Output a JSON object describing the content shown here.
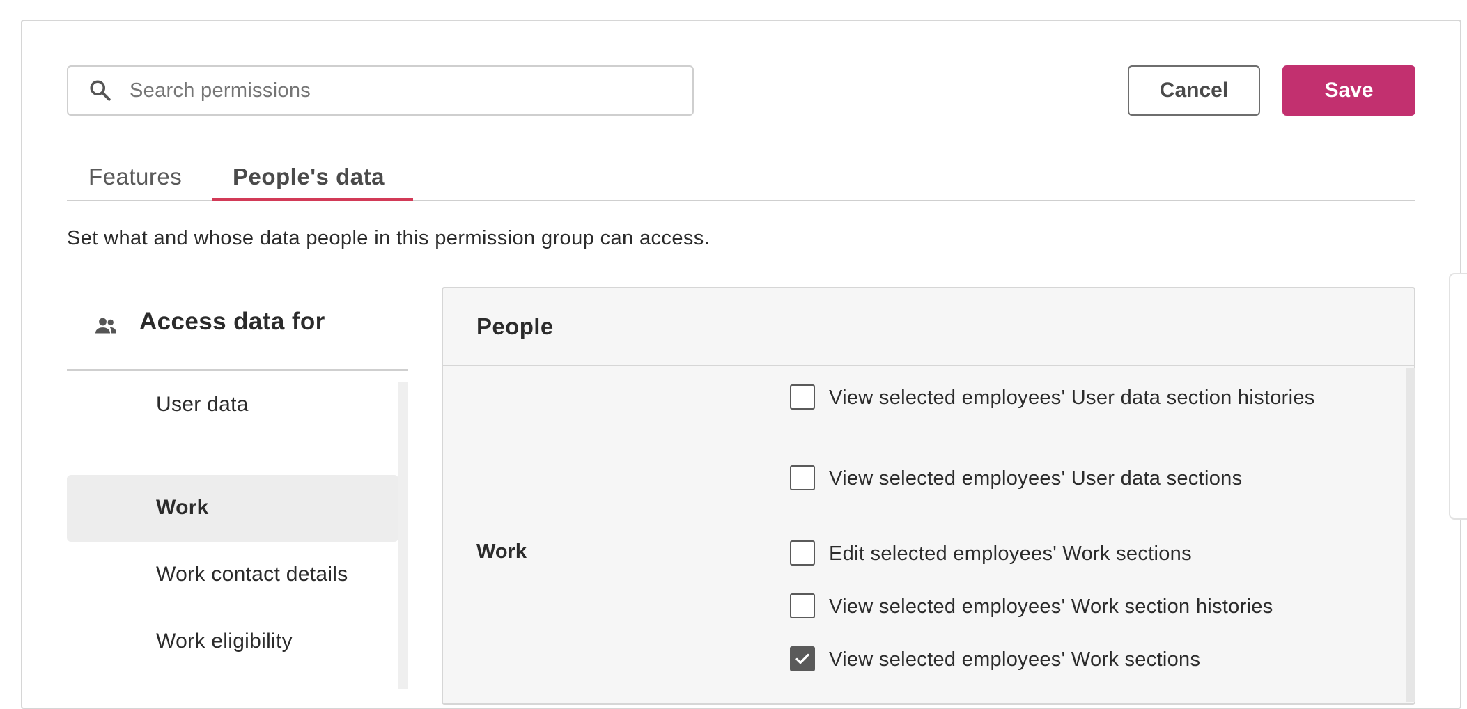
{
  "search": {
    "placeholder": "Search permissions",
    "icon": "search-icon"
  },
  "actions": {
    "cancel_label": "Cancel",
    "save_label": "Save"
  },
  "tabs": [
    {
      "label": "Features",
      "active": false
    },
    {
      "label": "People's data",
      "active": true
    }
  ],
  "description": "Set what and whose data people in this permission group can access.",
  "left_panel": {
    "icon": "people-icon",
    "title": "Access data for",
    "items": [
      {
        "label": "User data",
        "active": false
      },
      {
        "label": "Work",
        "active": true
      },
      {
        "label": "Work contact details",
        "active": false
      },
      {
        "label": "Work eligibility",
        "active": false
      }
    ]
  },
  "right_panel": {
    "title": "People",
    "sections": [
      {
        "label": "",
        "permissions": [
          {
            "label": "View selected employees' User data section histories",
            "checked": false
          },
          {
            "label": "View selected employees' User data sections",
            "checked": false
          }
        ]
      },
      {
        "label": "Work",
        "permissions": [
          {
            "label": "Edit selected employees' Work sections",
            "checked": false
          },
          {
            "label": "View selected employees' Work section histories",
            "checked": false
          },
          {
            "label": "View selected employees' Work sections",
            "checked": true
          }
        ]
      }
    ]
  },
  "colors": {
    "accent": "#c2306f",
    "tab_underline": "#d23a57",
    "checkbox_checked": "#5a5a5a"
  }
}
